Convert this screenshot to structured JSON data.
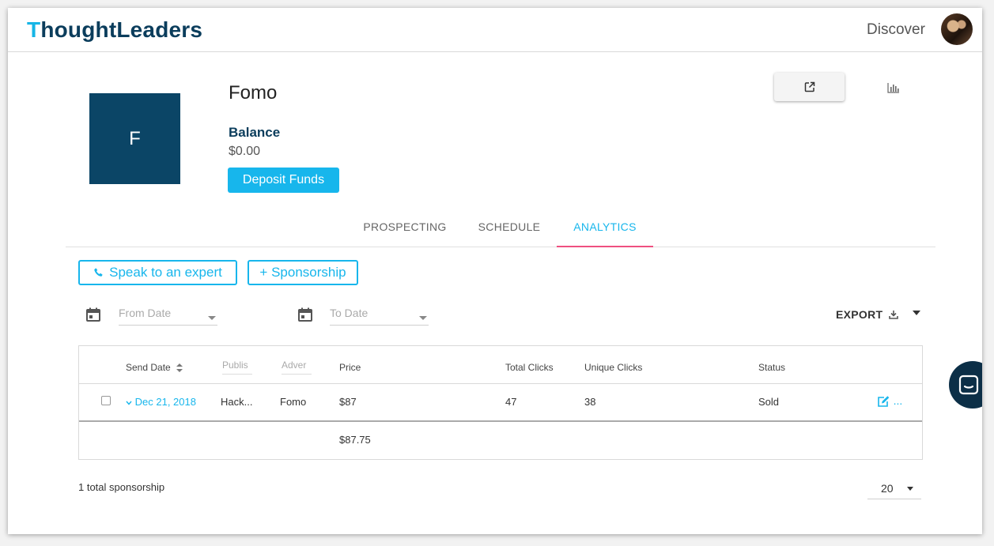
{
  "header": {
    "logo_mark": "T",
    "logo_text": "houghtLeaders",
    "discover_label": "Discover",
    "avatar_icon": "user-avatar"
  },
  "profile": {
    "initial": "F",
    "name": "Fomo",
    "balance_label": "Balance",
    "balance_value": "$0.00",
    "deposit_label": "Deposit Funds"
  },
  "tabs": [
    {
      "label": "PROSPECTING",
      "active": false
    },
    {
      "label": "SCHEDULE",
      "active": false
    },
    {
      "label": "ANALYTICS",
      "active": true
    }
  ],
  "actions": {
    "speak_label": "Speak to an expert",
    "sponsorship_label": "+ Sponsorship"
  },
  "filters": {
    "from_placeholder": "From Date",
    "to_placeholder": "To Date",
    "export_label": "EXPORT"
  },
  "table": {
    "columns": {
      "send_date": "Send Date",
      "publisher": "Publis",
      "advertiser": "Adver",
      "price": "Price",
      "total_clicks": "Total Clicks",
      "unique_clicks": "Unique Clicks",
      "status": "Status"
    },
    "rows": [
      {
        "send_date": "Dec 21, 2018",
        "publisher": "Hack...",
        "advertiser": "Fomo",
        "price": "$87",
        "total_clicks": "47",
        "unique_clicks": "38",
        "status": "Sold",
        "more": "..."
      }
    ],
    "footer_price": "$87.75"
  },
  "pagination": {
    "total_text": "1 total sponsorship",
    "page_size": "20"
  },
  "colors": {
    "brand_navy": "#0b3d5c",
    "accent_blue": "#17b6ec",
    "tab_underline": "#ef5080"
  }
}
